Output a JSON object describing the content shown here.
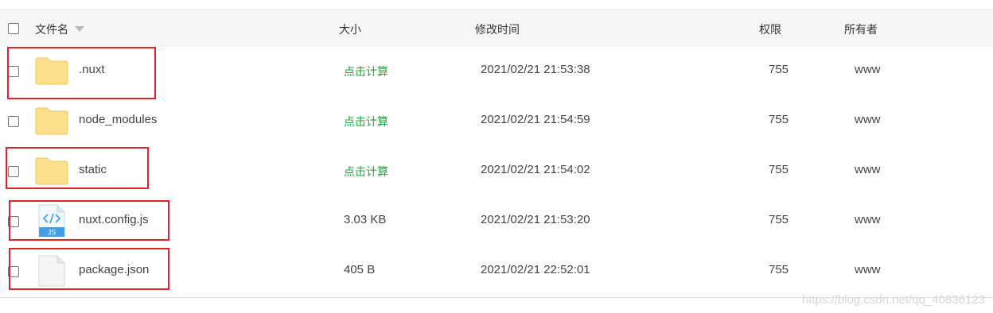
{
  "columns": {
    "name": "文件名",
    "size": "大小",
    "mtime": "修改时间",
    "perm": "权限",
    "owner": "所有者"
  },
  "rows": [
    {
      "name": ".nuxt",
      "type": "folder-icon",
      "size": "点击计算",
      "mtime": "2021/02/21 21:53:38",
      "perm": "755",
      "owner": "www",
      "highlighted": true
    },
    {
      "name": "node_modules",
      "type": "folder-icon",
      "size": "点击计算",
      "mtime": "2021/02/21 21:54:59",
      "perm": "755",
      "owner": "www",
      "highlighted": false
    },
    {
      "name": "static",
      "type": "folder-icon",
      "size": "点击计算",
      "mtime": "2021/02/21 21:54:02",
      "perm": "755",
      "owner": "www",
      "highlighted": true
    },
    {
      "name": "nuxt.config.js",
      "type": "js-file-icon",
      "size": "3.03 KB",
      "mtime": "2021/02/21 21:53:20",
      "perm": "755",
      "owner": "www",
      "highlighted": true
    },
    {
      "name": "package.json",
      "type": "file-icon",
      "size": "405 B",
      "mtime": "2021/02/21 22:52:01",
      "perm": "755",
      "owner": "www",
      "highlighted": true
    }
  ],
  "js_badge": "JS",
  "colors": {
    "folder": "#fde08b",
    "calc_link": "#20a53a",
    "highlight": "#e0242b",
    "js_badge": "#3e9ee6"
  },
  "watermark": "https://blog.csdn.net/qq_40836123"
}
